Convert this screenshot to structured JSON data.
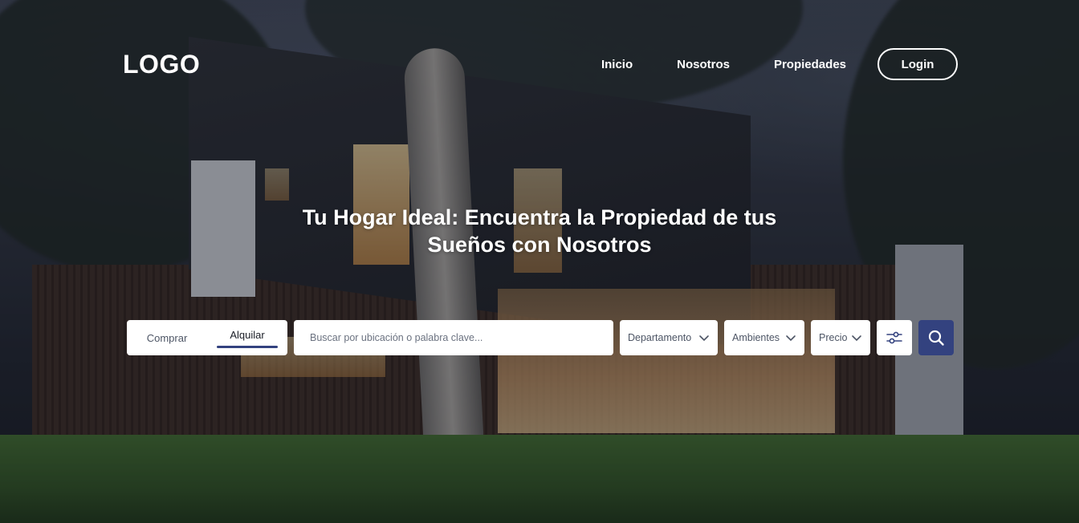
{
  "header": {
    "logo": "LOGO",
    "nav": [
      "Inicio",
      "Nosotros",
      "Propiedades"
    ],
    "login_label": "Login"
  },
  "hero": {
    "title_line1": "Tu Hogar Ideal: Encuentra la Propiedad de tus",
    "title_line2": "Sueños con Nosotros"
  },
  "search": {
    "tabs": [
      "Comprar",
      "Alquilar"
    ],
    "active_tab": "Alquilar",
    "placeholder": "Buscar por ubicación o palabra clave...",
    "filters": {
      "type": "Departamento",
      "rooms": "Ambientes",
      "price": "Precio"
    },
    "icons": {
      "filters": "sliders-icon",
      "submit": "search-icon",
      "dropdown": "chevron-down-icon"
    }
  },
  "colors": {
    "accent": "#33427f",
    "text_light": "#ffffff",
    "field_bg": "#ffffff",
    "field_text": "#4d5565"
  }
}
